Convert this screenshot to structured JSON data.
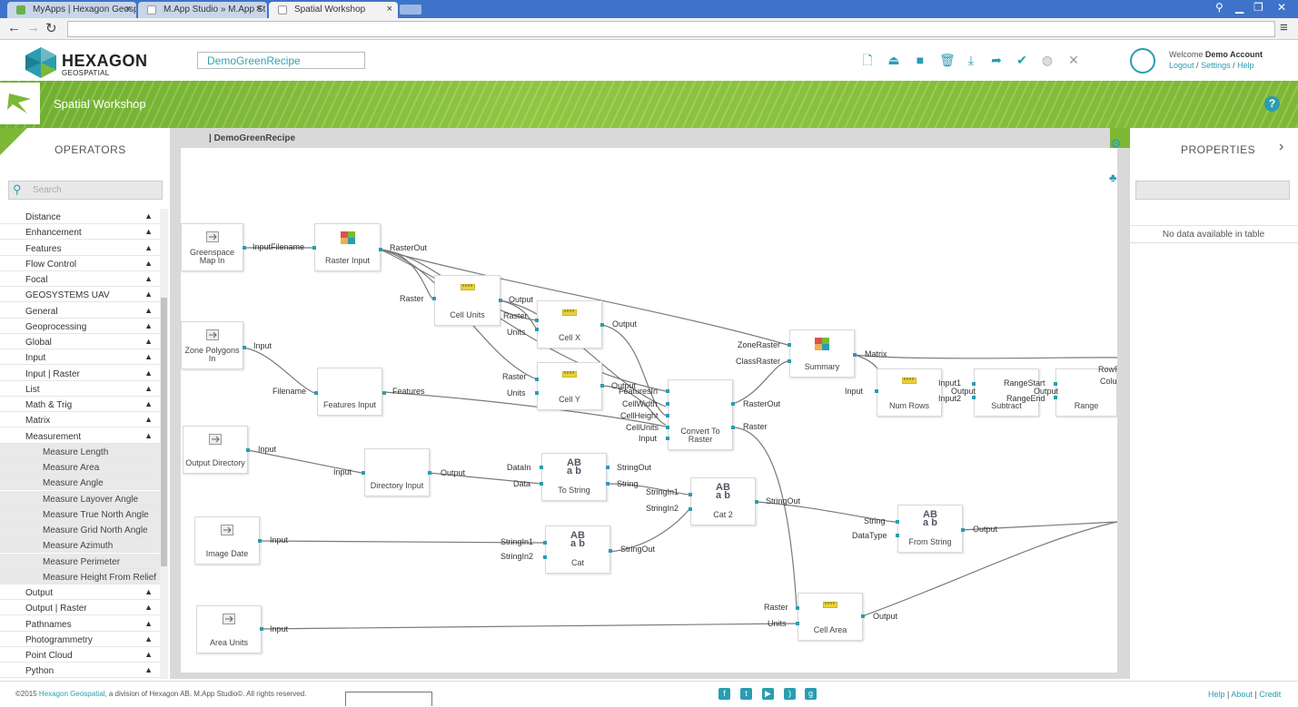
{
  "browser": {
    "tabs": [
      {
        "label": "MyApps | Hexagon Geosp"
      },
      {
        "label": "M.App Studio » M.App St"
      },
      {
        "label": "Spatial Workshop"
      }
    ],
    "close_glyph": "×"
  },
  "header": {
    "logo_text": "HEXAGON",
    "logo_sub": "GEOSPATIAL",
    "recipe_name": "DemoGreenRecipe",
    "welcome_prefix": "Welcome ",
    "user_name": "Demo Account",
    "logout": "Logout",
    "settings": "Settings",
    "help": "Help",
    "sep": "/"
  },
  "banner": {
    "title": "Spatial Workshop",
    "help_glyph": "?"
  },
  "operators": {
    "title": "OPERATORS",
    "search_placeholder": "Search",
    "items": [
      {
        "label": "Distance",
        "sub": false
      },
      {
        "label": "Enhancement",
        "sub": false
      },
      {
        "label": "Features",
        "sub": false
      },
      {
        "label": "Flow Control",
        "sub": false
      },
      {
        "label": "Focal",
        "sub": false
      },
      {
        "label": "GEOSYSTEMS UAV",
        "sub": false
      },
      {
        "label": "General",
        "sub": false
      },
      {
        "label": "Geoprocessing",
        "sub": false
      },
      {
        "label": "Global",
        "sub": false
      },
      {
        "label": "Input",
        "sub": false
      },
      {
        "label": "Input | Raster",
        "sub": false
      },
      {
        "label": "List",
        "sub": false
      },
      {
        "label": "Math & Trig",
        "sub": false
      },
      {
        "label": "Matrix",
        "sub": false
      },
      {
        "label": "Measurement",
        "sub": false
      },
      {
        "label": "Measure Length",
        "sub": true
      },
      {
        "label": "Measure Area",
        "sub": true
      },
      {
        "label": "Measure Angle",
        "sub": true
      },
      {
        "label": "Measure Layover Angle",
        "sub": true
      },
      {
        "label": "Measure True North Angle",
        "sub": true
      },
      {
        "label": "Measure Grid North Angle",
        "sub": true
      },
      {
        "label": "Measure Azimuth",
        "sub": true
      },
      {
        "label": "Measure Perimeter",
        "sub": true
      },
      {
        "label": "Measure Height From Relief",
        "sub": true
      },
      {
        "label": "Output",
        "sub": false
      },
      {
        "label": "Output | Raster",
        "sub": false
      },
      {
        "label": "Pathnames",
        "sub": false
      },
      {
        "label": "Photogrammetry",
        "sub": false
      },
      {
        "label": "Point Cloud",
        "sub": false
      },
      {
        "label": "Python",
        "sub": false
      }
    ],
    "expand_glyph": "▲"
  },
  "canvas": {
    "breadcrumb": "| DemoGreenRecipe",
    "nodes": {
      "greenspace": "Greenspace Map In",
      "raster_input": "Raster Input",
      "cell_units": "Cell Units",
      "cell_x": "Cell X",
      "cell_y": "Cell Y",
      "zone_polygons": "Zone Polygons In",
      "features_input": "Features Input",
      "convert": "Convert To Raster",
      "summary": "Summary",
      "num_rows": "Num Rows",
      "subtract": "Subtract",
      "range": "Range",
      "output_dir": "Output Directory",
      "directory_input": "Directory Input",
      "to_string": "To String",
      "cat2": "Cat 2",
      "from_string": "From String",
      "image_date": "Image Date",
      "cat": "Cat",
      "area_units": "Area Units",
      "cell_area": "Cell Area"
    },
    "ports": {
      "input": "Input",
      "filename": "Filename",
      "raster_out": "RasterOut",
      "raster": "Raster",
      "output": "Output",
      "units": "Units",
      "features": "Features",
      "features_in": "FeaturesIn",
      "cell_width": "CellWidth",
      "cell_height": "CellHeight",
      "cell_units": "CellUnits",
      "zone_raster": "ZoneRaster",
      "class_raster": "ClassRaster",
      "matrix": "Matrix",
      "input1": "Input1",
      "input2": "Input2",
      "range_start": "RangeStart",
      "range_end": "RangeEnd",
      "row_r": "RowR",
      "column_r": "ColumnR",
      "data_in": "DataIn",
      "data": "Data",
      "string_out": "StringOut",
      "string": "String",
      "string_in1": "StringIn1",
      "string_in2": "StringIn2",
      "data_type": "DataType"
    },
    "icon_ab": "AB",
    "icon_ab2": "a b"
  },
  "properties": {
    "title": "PROPERTIES",
    "empty_text": "No data available in table"
  },
  "footer": {
    "copyright": "©2015 ",
    "company": "Hexagon Geospatial",
    "rest": ", a division of Hexagon AB. M.App Studio©. All rights reserved.",
    "help": "Help",
    "about": "About",
    "credit": "Credit",
    "sep": "|"
  },
  "colors": {
    "accent": "#2a9db0",
    "green": "#7db835",
    "chrome": "#3d74c9"
  }
}
